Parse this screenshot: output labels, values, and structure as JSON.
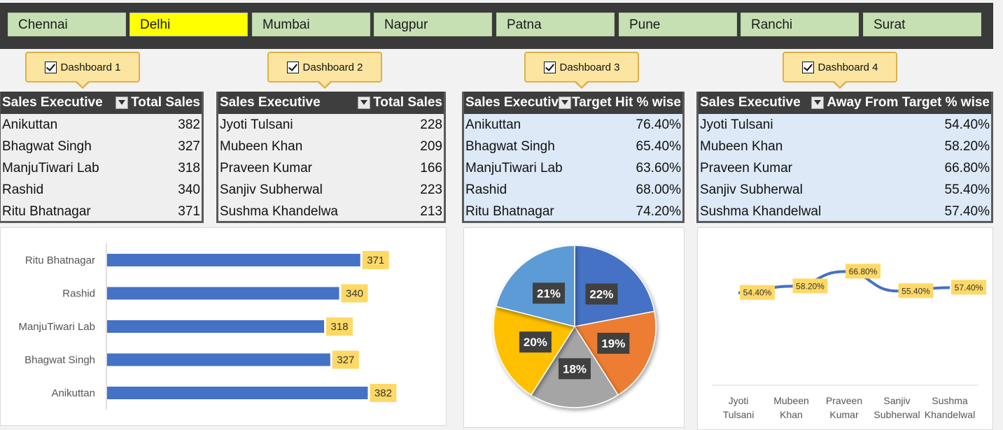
{
  "slicer": {
    "cities": [
      "Chennai",
      "Delhi",
      "Mumbai",
      "Nagpur",
      "Patna",
      "Pune",
      "Ranchi",
      "Surat"
    ],
    "selected": "Delhi"
  },
  "callouts": [
    "Dashboard 1",
    "Dashboard 2",
    "Dashboard 3",
    "Dashboard 4"
  ],
  "tables": [
    {
      "col1": "Sales Executive",
      "col2": "Total Sales",
      "rows": [
        {
          "name": "Anikuttan",
          "value": "382"
        },
        {
          "name": "Bhagwat Singh",
          "value": "327"
        },
        {
          "name": "ManjuTiwari Lab",
          "value": "318"
        },
        {
          "name": "Rashid",
          "value": "340"
        },
        {
          "name": "Ritu Bhatnagar",
          "value": "371"
        }
      ]
    },
    {
      "col1": "Sales Executive",
      "col2": "Total Sales",
      "rows": [
        {
          "name": "Jyoti Tulsani",
          "value": "228"
        },
        {
          "name": "Mubeen Khan",
          "value": "209"
        },
        {
          "name": "Praveen Kumar",
          "value": "166"
        },
        {
          "name": "Sanjiv Subherwal",
          "value": "223"
        },
        {
          "name": "Sushma Khandelwa",
          "value": "213"
        }
      ]
    },
    {
      "col1": "Sales Executiv",
      "col2": "Target Hit % wise",
      "rows": [
        {
          "name": "Anikuttan",
          "value": "76.40%"
        },
        {
          "name": "Bhagwat Singh",
          "value": "65.40%"
        },
        {
          "name": "ManjuTiwari Lab",
          "value": "63.60%"
        },
        {
          "name": "Rashid",
          "value": "68.00%"
        },
        {
          "name": "Ritu Bhatnagar",
          "value": "74.20%"
        }
      ]
    },
    {
      "col1": "Sales Executive",
      "col2": "Away From Target % wise",
      "rows": [
        {
          "name": "Jyoti Tulsani",
          "value": "54.40%"
        },
        {
          "name": "Mubeen Khan",
          "value": "58.20%"
        },
        {
          "name": "Praveen Kumar",
          "value": "66.80%"
        },
        {
          "name": "Sanjiv Subherwal",
          "value": "55.40%"
        },
        {
          "name": "Sushma Khandelwal",
          "value": "57.40%"
        }
      ]
    }
  ],
  "colors": {
    "bar": "#4472c4",
    "badge": "#ffd966",
    "pie": [
      "#4472c4",
      "#ed7d31",
      "#a5a5a5",
      "#ffc000",
      "#5b9bd5"
    ],
    "line": "#4472c4",
    "selected_city": "#ffff00",
    "city": "#c6e0b4"
  },
  "chart_data": [
    {
      "type": "bar",
      "orientation": "horizontal",
      "categories": [
        "Ritu Bhatnagar",
        "Rashid",
        "ManjuTiwari Lab",
        "Bhagwat Singh",
        "Anikuttan"
      ],
      "values": [
        371,
        340,
        318,
        327,
        382
      ],
      "labels": [
        "371",
        "340",
        "318",
        "327",
        "382"
      ],
      "xlim": [
        0,
        400
      ],
      "grid": false
    },
    {
      "type": "pie",
      "categories": [
        "Anikuttan",
        "Bhagwat Singh",
        "ManjuTiwari Lab",
        "Rashid",
        "Ritu Bhatnagar"
      ],
      "values": [
        22,
        19,
        18,
        20,
        21
      ],
      "labels": [
        "22%",
        "19%",
        "18%",
        "20%",
        "21%"
      ]
    },
    {
      "type": "line",
      "categories": [
        "Jyoti Tulsani",
        "Mubeen Khan",
        "Praveen Kumar",
        "Sanjiv Subherwal",
        "Sushma Khandelwal"
      ],
      "category_lines": [
        [
          "Jyoti",
          "Tulsani"
        ],
        [
          "Mubeen",
          "Khan"
        ],
        [
          "Praveen",
          "Kumar"
        ],
        [
          "Sanjiv",
          "Subherwal"
        ],
        [
          "Sushma",
          "Khandelwal"
        ]
      ],
      "values": [
        54.4,
        58.2,
        66.8,
        55.4,
        57.4
      ],
      "labels": [
        "54.40%",
        "58.20%",
        "66.80%",
        "55.40%",
        "57.40%"
      ],
      "ylim": [
        0,
        80
      ],
      "grid": false
    }
  ]
}
